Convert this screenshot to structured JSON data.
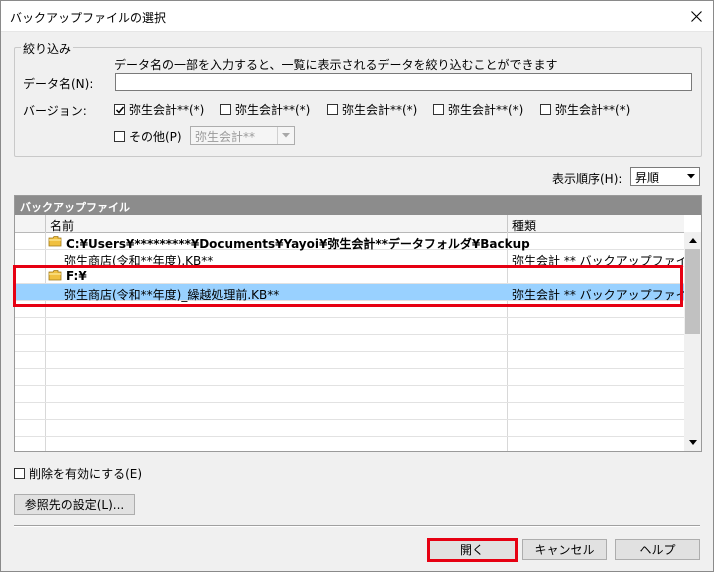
{
  "window": {
    "title": "バックアップファイルの選択"
  },
  "filter": {
    "group_label": "絞り込み",
    "hint": "データ名の一部を入力すると、一覧に表示されるデータを絞り込むことができます",
    "data_name_label": "データ名(N):",
    "data_name_value": "",
    "version_label": "バージョン:",
    "versions": [
      {
        "label": "弥生会計**(*)",
        "checked": true
      },
      {
        "label": "弥生会計**(*)",
        "checked": false
      },
      {
        "label": "弥生会計**(*)",
        "checked": false
      },
      {
        "label": "弥生会計**(*)",
        "checked": false
      },
      {
        "label": "弥生会計**(*)",
        "checked": false
      }
    ],
    "other_label": "その他(P)",
    "other_select_value": "弥生会計**"
  },
  "sort": {
    "label": "表示順序(H):",
    "value": "昇順"
  },
  "list": {
    "header": "バックアップファイル",
    "columns": {
      "name": "名前",
      "type": "種類"
    },
    "rows": [
      {
        "kind": "folder",
        "name": "C:¥Users¥*********¥Documents¥Yayoi¥弥生会計**データフォルダ¥Backup",
        "type": ""
      },
      {
        "kind": "file",
        "name": "弥生商店(令和**年度).KB**",
        "type": "弥生会計 ** バックアップファイル"
      },
      {
        "kind": "folder",
        "name": "F:¥",
        "type": ""
      },
      {
        "kind": "file",
        "name": "弥生商店(令和**年度)_繰越処理前.KB**",
        "type": "弥生会計 ** バックアップファイル",
        "selected": true
      }
    ]
  },
  "enable_delete_label": "削除を有効にする(E)",
  "browse_button": "参照先の設定(L)...",
  "buttons": {
    "open": "開く",
    "cancel": "キャンセル",
    "help": "ヘルプ"
  },
  "colors": {
    "selection": "#99d1ff",
    "highlight": "#e60012",
    "header_bg": "#8c8c8c"
  }
}
